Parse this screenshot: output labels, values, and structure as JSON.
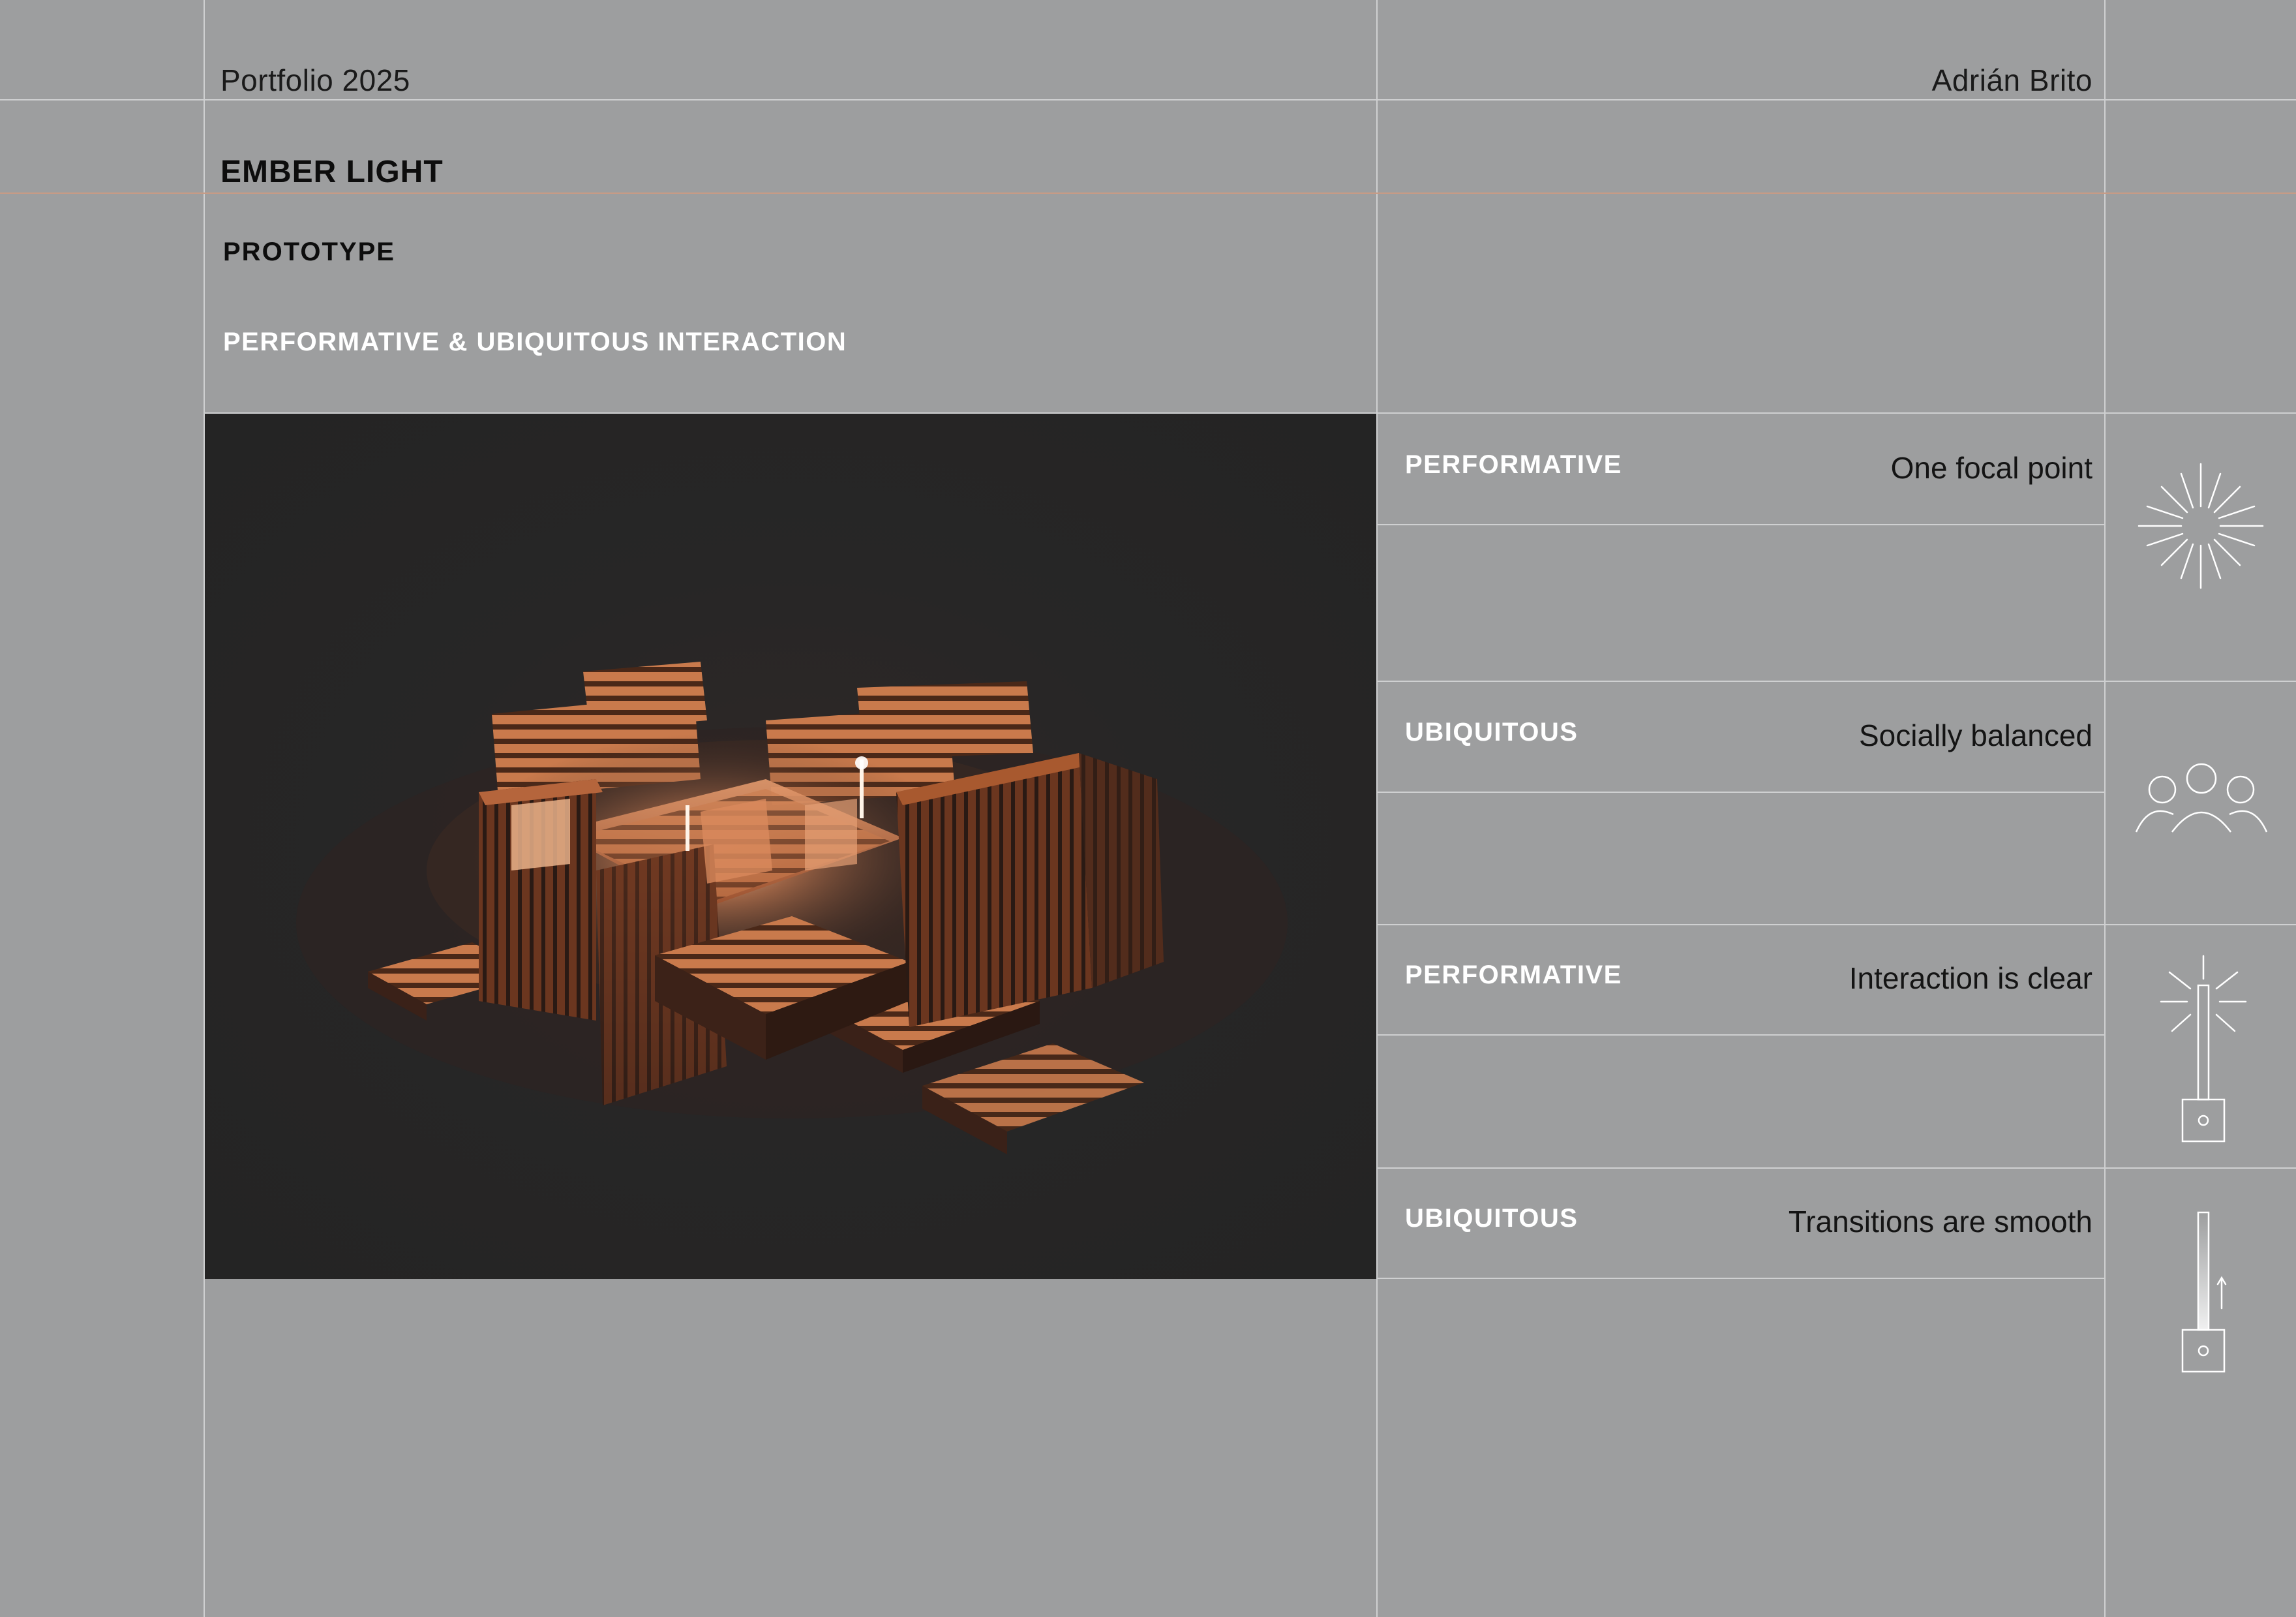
{
  "header": {
    "portfolio": "Portfolio 2025",
    "author": "Adrián Brito"
  },
  "project": {
    "title": "EMBER LIGHT",
    "subtitle": "PROTOTYPE",
    "theme": "PERFORMATIVE & UBIQUITOUS INTERACTION"
  },
  "principles": [
    {
      "label": "PERFORMATIVE",
      "description": "One focal point",
      "icon": "sunburst-icon"
    },
    {
      "label": "UBIQUITOUS",
      "description": "Socially balanced",
      "icon": "people-group-icon"
    },
    {
      "label": "PERFORMATIVE",
      "description": "Interaction is clear",
      "icon": "light-pole-burst-icon"
    },
    {
      "label": "UBIQUITOUS",
      "description": "Transitions are smooth",
      "icon": "light-pole-gradient-icon"
    }
  ],
  "image": {
    "subject": "pallet-structure-render"
  },
  "colors": {
    "background": "#9d9e9f",
    "grid": "#cfd0d1",
    "accent": "#c79b85",
    "render_background": "#262626",
    "wood": "#b8643c"
  }
}
